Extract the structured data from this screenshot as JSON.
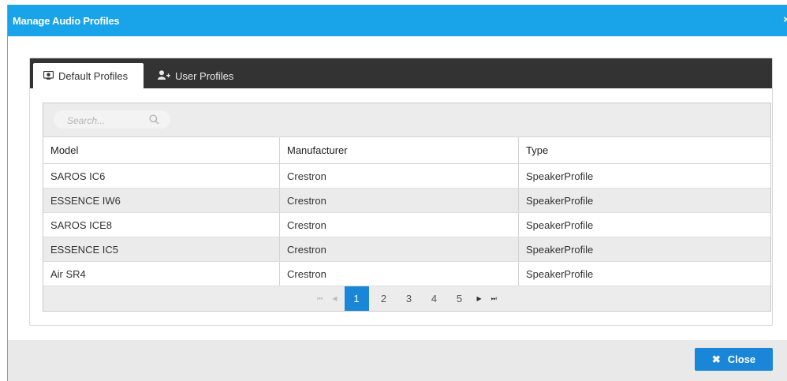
{
  "dialog": {
    "title": "Manage Audio Profiles",
    "close_glyph": "×"
  },
  "tabs": [
    {
      "label": "Default Profiles",
      "icon": "speaker-icon",
      "active": true
    },
    {
      "label": "User Profiles",
      "icon": "add-user-icon",
      "active": false
    }
  ],
  "search": {
    "placeholder": "Search...",
    "value": ""
  },
  "table": {
    "columns": [
      "Model",
      "Manufacturer",
      "Type"
    ],
    "rows": [
      [
        "SAROS IC6",
        "Crestron",
        "SpeakerProfile"
      ],
      [
        "ESSENCE IW6",
        "Crestron",
        "SpeakerProfile"
      ],
      [
        "SAROS ICE8",
        "Crestron",
        "SpeakerProfile"
      ],
      [
        "ESSENCE IC5",
        "Crestron",
        "SpeakerProfile"
      ],
      [
        "Air SR4",
        "Crestron",
        "SpeakerProfile"
      ]
    ]
  },
  "pager": {
    "first": "⏮",
    "prev": "◀",
    "next": "▶",
    "last": "⏭",
    "pages": [
      "1",
      "2",
      "3",
      "4",
      "5"
    ],
    "current_page": "1"
  },
  "footer": {
    "close_label": "Close",
    "close_icon": "✖"
  },
  "colors": {
    "titlebar": "#19a3e8",
    "accent": "#1a86d8",
    "tabbar": "#333333"
  }
}
